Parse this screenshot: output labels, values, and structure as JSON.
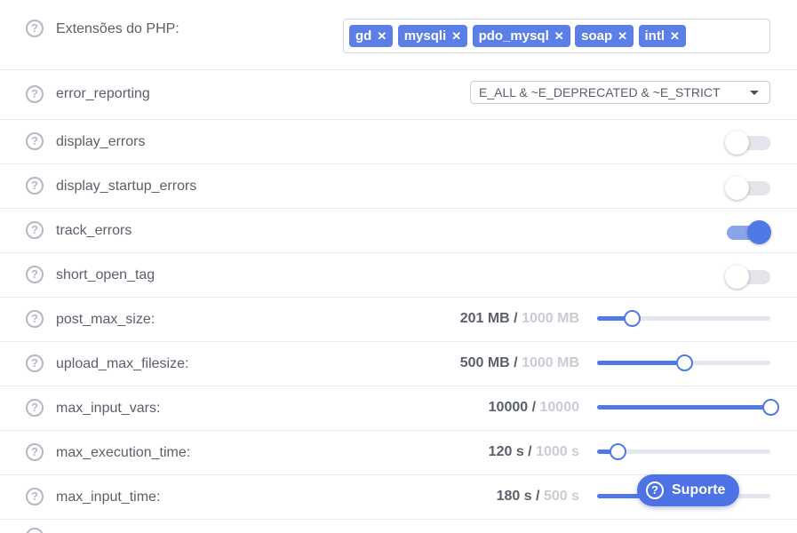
{
  "settings": {
    "extensions": {
      "label": "Extensões do PHP:",
      "tags": [
        "gd",
        "mysqli",
        "pdo_mysql",
        "soap",
        "intl"
      ],
      "remove_glyph": "✕"
    },
    "error_reporting": {
      "label": "error_reporting",
      "value": "E_ALL & ~E_DEPRECATED & ~E_STRICT"
    },
    "toggles": [
      {
        "label": "display_errors",
        "on": false
      },
      {
        "label": "display_startup_errors",
        "on": false
      },
      {
        "label": "track_errors",
        "on": true
      },
      {
        "label": "short_open_tag",
        "on": false
      }
    ],
    "sliders": [
      {
        "label": "post_max_size:",
        "current": "201 MB /",
        "max": "1000 MB",
        "fraction": 0.2
      },
      {
        "label": "upload_max_filesize:",
        "current": "500 MB /",
        "max": "1000 MB",
        "fraction": 0.5
      },
      {
        "label": "max_input_vars:",
        "current": "10000 /",
        "max": "10000",
        "fraction": 1.0
      },
      {
        "label": "max_execution_time:",
        "current": "120 s /",
        "max": "1000 s",
        "fraction": 0.12
      },
      {
        "label": "max_input_time:",
        "current": "180 s /",
        "max": "500 s",
        "fraction": 0.36
      }
    ]
  },
  "help_glyph": "?",
  "support_button": {
    "label": "Suporte",
    "icon": "help-circle-icon"
  },
  "colors": {
    "accent": "#5079e6",
    "tag_bg": "#5b7fe7",
    "muted_text": "#c9ccd3"
  }
}
